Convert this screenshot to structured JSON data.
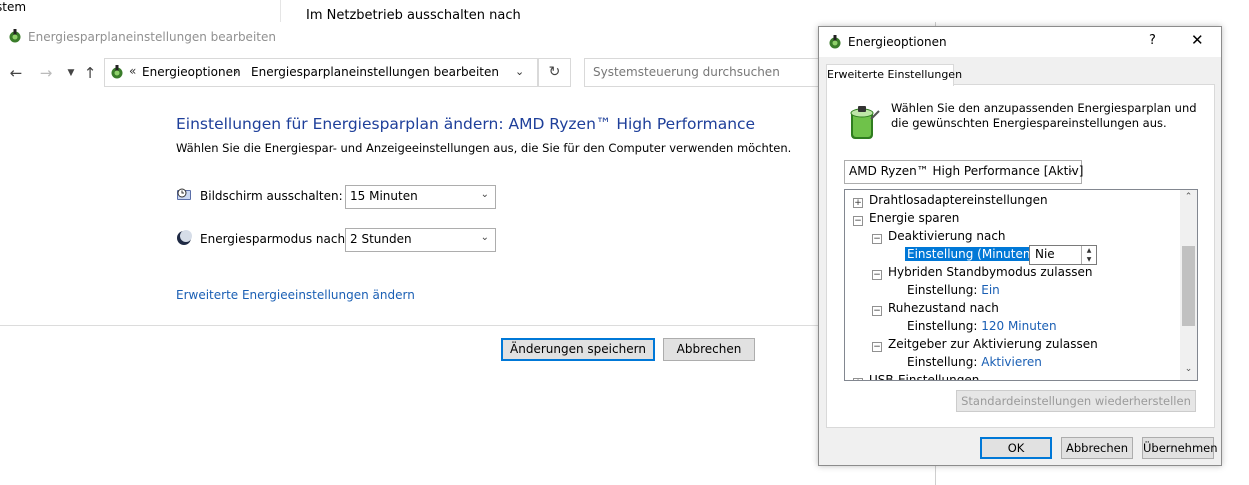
{
  "background": {
    "left_text": "stem",
    "right_text": "Im Netzbetrieb ausschalten nach"
  },
  "control_panel": {
    "title": "Energiesparplaneinstellungen bearbeiten",
    "address": {
      "overflow": "«",
      "crumb1": "Energieoptionen",
      "separator": "›",
      "crumb2": "Energiesparplaneinstellungen bearbeiten"
    },
    "search_placeholder": "Systemsteuerung durchsuchen",
    "heading": "Einstellungen für Energiesparplan ändern: AMD Ryzen™ High Performance",
    "subheading": "Wählen Sie die Energiespar- und Anzeigeeinstellungen aus, die Sie für den Computer verwenden möchten.",
    "display_off_label": "Bildschirm ausschalten:",
    "display_off_value": "15 Minuten",
    "sleep_label": "Energiesparmodus nach:",
    "sleep_value": "2 Stunden",
    "advanced_link": "Erweiterte Energieeinstellungen ändern",
    "save_button": "Änderungen speichern",
    "cancel_button": "Abbrechen"
  },
  "dialog": {
    "title": "Energieoptionen",
    "help": "?",
    "close": "✕",
    "tab": "Erweiterte Einstellungen",
    "description": "Wählen Sie den anzupassenden Energiesparplan und die gewünschten Energiespareinstellungen aus.",
    "plan_select": "AMD Ryzen™ High Performance [Aktiv]",
    "tree": {
      "wireless": "Drahtlosadaptereinstellungen",
      "energy_save": "Energie sparen",
      "deactivate_after": "Deaktivierung nach",
      "setting_minutes_label": "Einstellung (Minuten):",
      "setting_minutes_value": "Nie",
      "hybrid_sleep": "Hybriden Standbymodus zulassen",
      "hybrid_setting_label": "Einstellung:",
      "hybrid_setting_value": "Ein",
      "hibernate_after": "Ruhezustand nach",
      "hibernate_setting_label": "Einstellung:",
      "hibernate_setting_value": "120 Minuten",
      "wake_timers": "Zeitgeber zur Aktivierung zulassen",
      "wake_setting_label": "Einstellung:",
      "wake_setting_value": "Aktivieren",
      "usb": "USB-Einstellungen"
    },
    "restore_button": "Standardeinstellungen wiederherstellen",
    "ok_button": "OK",
    "cancel_button": "Abbrechen",
    "apply_button": "Übernehmen"
  },
  "colors": {
    "heading": "#1e3f9a",
    "link": "#1a5fb4",
    "selection": "#0078d7"
  }
}
